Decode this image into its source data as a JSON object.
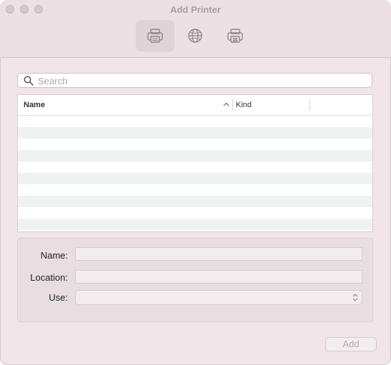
{
  "window": {
    "title": "Add Printer"
  },
  "toolbar": {
    "items": [
      {
        "icon": "default-printer-icon",
        "selected": true
      },
      {
        "icon": "ip-globe-icon",
        "selected": false
      },
      {
        "icon": "windows-printer-icon",
        "selected": false
      }
    ]
  },
  "search": {
    "placeholder": "Search",
    "value": ""
  },
  "table": {
    "columns": [
      "Name",
      "Kind"
    ],
    "sorted_column": "Name",
    "sort_direction": "ascending",
    "rows": []
  },
  "details": {
    "name_label": "Name:",
    "name_value": "",
    "location_label": "Location:",
    "location_value": "",
    "use_label": "Use:",
    "use_value": ""
  },
  "actions": {
    "add_label": "Add",
    "add_enabled": false
  },
  "colors": {
    "window_bg": "#f1e5e9",
    "titlebar_bg": "#ece0e4",
    "alternate_row": "#eef3f1"
  }
}
